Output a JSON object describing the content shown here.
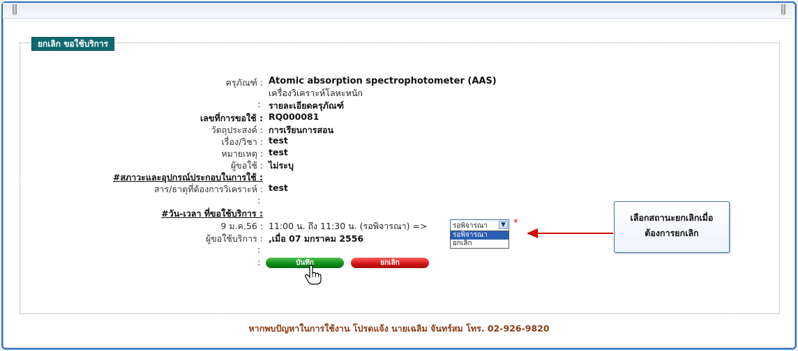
{
  "legend": "ยกเลิก ขอใช้บริการ",
  "form": {
    "instrument_label": "ครุภัณฑ์ :",
    "instrument_name": "Atomic absorption spectrophotometer (AAS)",
    "instrument_sub": "เครื่องวิเคราะห์โลหะหนัก",
    "detail_colon": ":",
    "detail_link": "รายละเอียดครุภัณฑ์",
    "request_no_label": "เลขที่การขอใช้ :",
    "request_no": "RQ000081",
    "purpose_label": "วัตถุประสงค์ :",
    "purpose": "การเรียนการสอน",
    "subject_label": "เรื่อง/วิชา :",
    "subject": "test",
    "remark_label": "หมายเหตุ :",
    "remark": "test",
    "requester_label": "ผู้ขอใช้ :",
    "requester": "ไม่ระบุ",
    "condition_label": "#สภาวะและอุปกรณ์ประกอบในการใช้ :",
    "substance_label": "สาร/ธาตุที่ต้องการวิเคราะห์ :",
    "substance": "test",
    "blank_colon": ":",
    "datetime_label": "#วัน-เวลา ที่ขอใช้บริการ :",
    "date_label": "9 ม.ค.56 :",
    "time_range": "11:00 น. ถึง 11:30 น. (รอพิจารณา) =>",
    "service_requester_label": "ผู้ขอใช้บริการ :",
    "service_requester": ",เมื่อ 07 มกราคม 2556"
  },
  "status_select": {
    "value": "รอพิจารณา",
    "options": [
      "รอพิจารณา",
      "ยกเลิก"
    ],
    "required_mark": "*"
  },
  "buttons": {
    "save": "บันทึก",
    "cancel": "ยกเลิก"
  },
  "callout": {
    "line1": "เลือกสถานะยกเลิกเมื่อ",
    "line2": "ต้องการยกเลิก"
  },
  "footer": "หากพบปัญหาในการใช้งาน โปรดแจ้ง นายเฉลิม จันทร์สม โทร. 02-926-9820",
  "colors": {
    "frame": "#2f6fc0",
    "legend_bg": "#0f6a70",
    "save_btn": "#0d8a1a",
    "cancel_btn": "#d21414",
    "footer_text": "#8a3b12",
    "arrow": "#d40000"
  }
}
